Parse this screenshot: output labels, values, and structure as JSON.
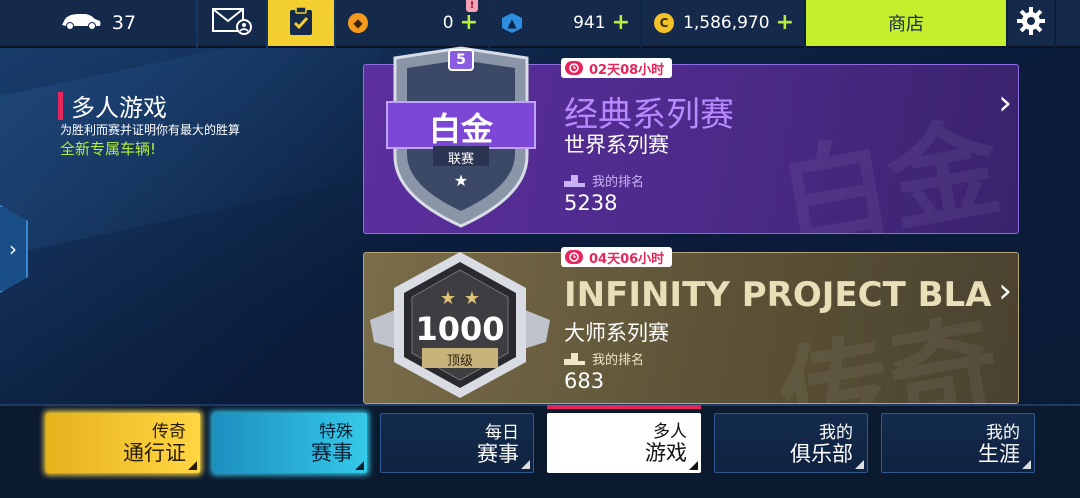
{
  "topbar": {
    "cars_count": "37",
    "coins_plus": "0",
    "tokens": "941",
    "credits": "1,586,970",
    "shop_label": "商店",
    "alert_mark": "!"
  },
  "mode": {
    "title": "多人游戏",
    "subtitle": "为胜利而赛并证明你有最大的胜算",
    "new_vehicles": "全新专属车辆!"
  },
  "cards": [
    {
      "timer": "02天08小时",
      "badge_number": "5",
      "badge_name": "白金",
      "badge_sub": "联赛",
      "title": "经典系列赛",
      "subtitle": "世界系列赛",
      "rank_label": "我的排名",
      "rank": "5238",
      "watermark": "白金"
    },
    {
      "timer": "04天06小时",
      "badge_number": "1000",
      "badge_sub": "顶级",
      "title": "INFINITY PROJECT BLA",
      "subtitle": "大师系列赛",
      "rank_label": "我的排名",
      "rank": "683",
      "watermark": "传奇"
    }
  ],
  "nav": [
    {
      "l1": "传奇",
      "l2": "通行证"
    },
    {
      "l1": "特殊",
      "l2": "赛事"
    },
    {
      "l1": "每日",
      "l2": "赛事"
    },
    {
      "l1": "多人",
      "l2": "游戏"
    },
    {
      "l1": "我的",
      "l2": "俱乐部"
    },
    {
      "l1": "我的",
      "l2": "生涯"
    }
  ],
  "colors": {
    "accent_pink": "#e8245c",
    "shop_green": "#c6f02e",
    "plus_green": "#b4ee3c",
    "purple_card": "#5c2f9e",
    "gold_card": "#7a6d4a"
  },
  "icons": {
    "car": "car-icon",
    "mail": "mail-icon",
    "task": "clipboard-check-icon",
    "coin_orange": "coin-icon",
    "token_blue": "token-icon",
    "credits": "credits-icon",
    "settings": "gear-icon",
    "timer": "stopwatch-icon",
    "rank": "podium-icon"
  }
}
